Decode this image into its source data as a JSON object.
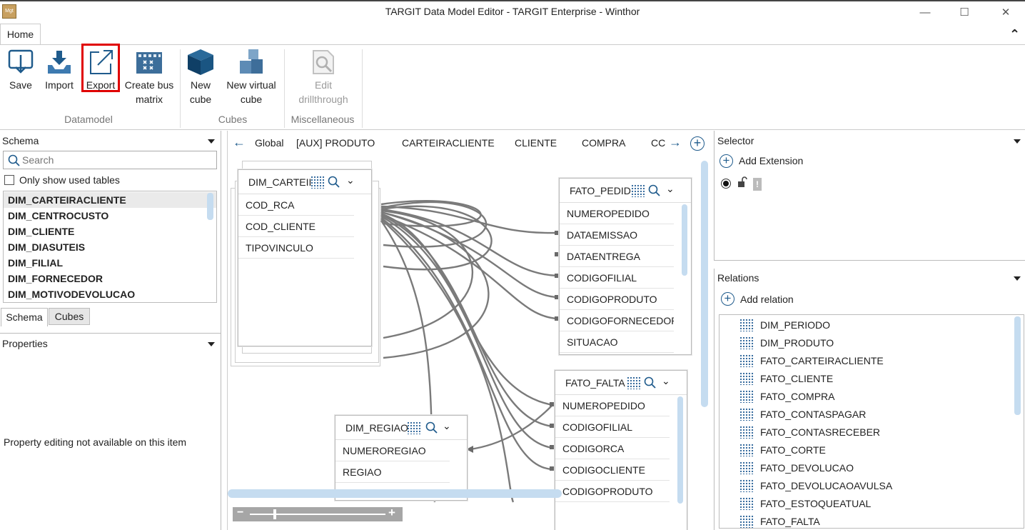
{
  "app": {
    "title": "TARGIT Data Model Editor - TARGIT Enterprise - Winthor",
    "minimize": "—",
    "maximize": "☐",
    "close": "✕",
    "logo_text": "Mgt"
  },
  "ribbon": {
    "tab": "Home",
    "collapse": "⌃",
    "groups": {
      "datamodel": "Datamodel",
      "cubes": "Cubes",
      "misc": "Miscellaneous"
    },
    "buttons": {
      "save": "Save",
      "import": "Import",
      "export": "Export",
      "bus_line1": "Create bus",
      "bus_line2": "matrix",
      "newcube_line1": "New",
      "newcube_line2": "cube",
      "virtual_line1": "New virtual",
      "virtual_line2": "cube",
      "drill_line1": "Edit",
      "drill_line2": "drillthrough"
    }
  },
  "schema": {
    "header": "Schema",
    "search_placeholder": "Search",
    "only_used": "Only show used tables",
    "tables": [
      "DIM_CARTEIRACLIENTE",
      "DIM_CENTROCUSTO",
      "DIM_CLIENTE",
      "DIM_DIASUTEIS",
      "DIM_FILIAL",
      "DIM_FORNECEDOR",
      "DIM_MOTIVODEVOLUCAO"
    ],
    "tabs": [
      "Schema",
      "Cubes"
    ]
  },
  "properties": {
    "header": "Properties",
    "message": "Property editing not available on this item"
  },
  "canvas": {
    "back_arrow": "←",
    "forward_arrow": "→",
    "add": "+",
    "breadcrumbs": [
      "Global",
      "[AUX] PRODUTO",
      "CARTEIRACLIENTE",
      "CLIENTE",
      "COMPRA",
      "CC"
    ],
    "tables": {
      "dim_carteira": {
        "title": "DIM_CARTEII",
        "fields": [
          "COD_RCA",
          "COD_CLIENTE",
          "TIPOVINCULO"
        ]
      },
      "fato_pedido": {
        "title": "FATO_PEDIDO",
        "fields": [
          "NUMEROPEDIDO",
          "DATAEMISSAO",
          "DATAENTREGA",
          "CODIGOFILIAL",
          "CODIGOPRODUTO",
          "CODIGOFORNECEDOR",
          "SITUACAO"
        ]
      },
      "fato_falta": {
        "title": "FATO_FALTA",
        "fields": [
          "NUMEROPEDIDO",
          "CODIGOFILIAL",
          "CODIGORCA",
          "CODIGOCLIENTE",
          "CODIGOPRODUTO"
        ]
      },
      "dim_regiao": {
        "title": "DIM_REGIAO",
        "fields": [
          "NUMEROREGIAO",
          "REGIAO"
        ]
      }
    },
    "zoom": {
      "minus": "−",
      "plus": "+"
    }
  },
  "selector": {
    "header": "Selector",
    "add_extension": "Add Extension"
  },
  "relations": {
    "header": "Relations",
    "add_relation": "Add relation",
    "items": [
      "DIM_PERIODO",
      "DIM_PRODUTO",
      "FATO_CARTEIRACLIENTE",
      "FATO_CLIENTE",
      "FATO_COMPRA",
      "FATO_CONTASPAGAR",
      "FATO_CONTASRECEBER",
      "FATO_CORTE",
      "FATO_DEVOLUCAO",
      "FATO_DEVOLUCAOAVULSA",
      "FATO_ESTOQUEATUAL",
      "FATO_FALTA"
    ]
  },
  "colors": {
    "accent": "#1f5b8c",
    "highlight": "#e00000",
    "scroll": "#c5dcf0"
  }
}
